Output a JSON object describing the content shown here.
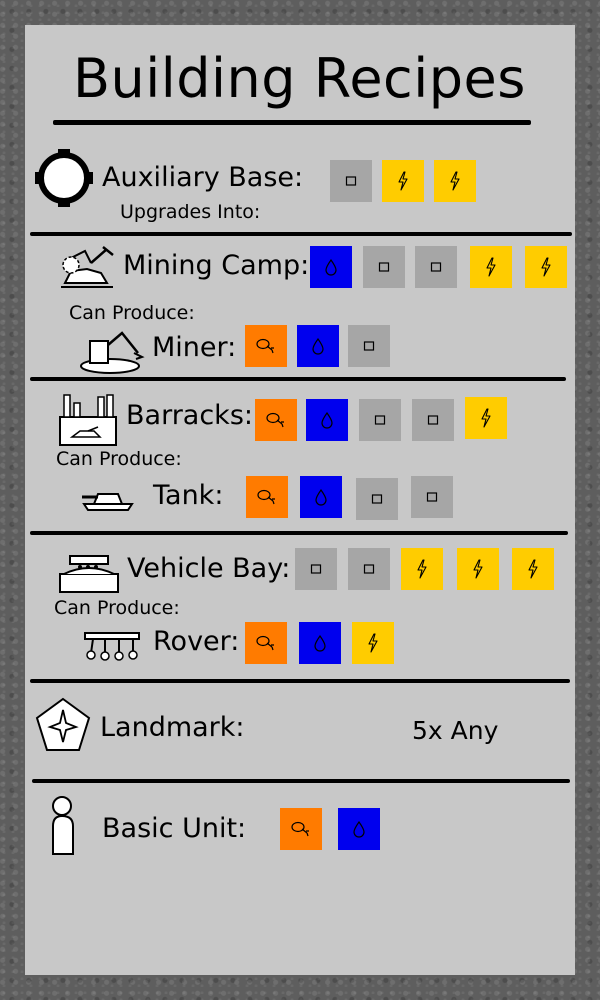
{
  "title": "Building Recipes",
  "colors": {
    "stone": "#a6a6a6",
    "energy": "#ffcc00",
    "water": "#0000ee",
    "food": "#ff7b00",
    "panel": "#c8c8c8",
    "frame": "#5e5e5e"
  },
  "resource_icons": {
    "stone": "square-outline-icon",
    "energy": "lightning-icon",
    "water": "droplet-icon",
    "food": "drumstick-icon"
  },
  "buildings": [
    {
      "name": "Auxiliary Base:",
      "icon": "auxiliary-base-icon",
      "cost": [
        "stone",
        "energy",
        "energy"
      ],
      "note": "Upgrades Into:"
    },
    {
      "name": "Mining Camp:",
      "icon": "mining-camp-icon",
      "cost": [
        "water",
        "stone",
        "stone",
        "energy",
        "energy"
      ],
      "produces_label": "Can Produce:",
      "unit": {
        "name": "Miner:",
        "icon": "miner-icon",
        "cost": [
          "food",
          "water",
          "stone"
        ]
      }
    },
    {
      "name": "Barracks:",
      "icon": "barracks-icon",
      "cost": [
        "food",
        "water",
        "stone",
        "stone",
        "energy"
      ],
      "produces_label": "Can Produce:",
      "unit": {
        "name": "Tank:",
        "icon": "tank-icon",
        "cost": [
          "food",
          "water",
          "stone",
          "stone"
        ]
      }
    },
    {
      "name": "Vehicle Bay:",
      "icon": "vehicle-bay-icon",
      "cost": [
        "stone",
        "stone",
        "energy",
        "energy",
        "energy"
      ],
      "produces_label": "Can Produce:",
      "unit": {
        "name": "Rover:",
        "icon": "rover-icon",
        "cost": [
          "food",
          "water",
          "energy"
        ]
      }
    },
    {
      "name": "Landmark:",
      "icon": "landmark-icon",
      "cost_text": "5x Any"
    },
    {
      "name": "Basic Unit:",
      "icon": "basic-unit-icon",
      "cost": [
        "food",
        "water"
      ]
    }
  ]
}
